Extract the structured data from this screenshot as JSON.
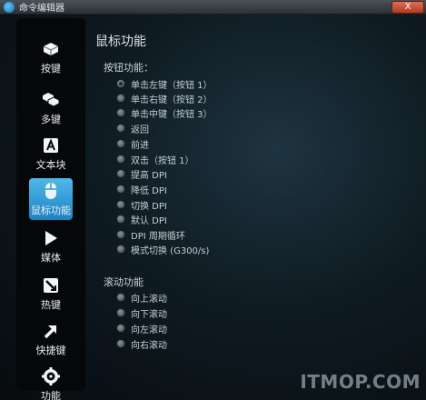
{
  "window": {
    "title": "命令编辑器",
    "close_label": "X"
  },
  "sidebar": {
    "items": [
      {
        "label": "按键",
        "icon": "key-icon",
        "active": false
      },
      {
        "label": "多键",
        "icon": "multi-key-icon",
        "active": false
      },
      {
        "label": "文本块",
        "icon": "text-block-icon",
        "active": false
      },
      {
        "label": "鼠标功能",
        "icon": "mouse-icon",
        "active": true
      },
      {
        "label": "媒体",
        "icon": "play-icon",
        "active": false
      },
      {
        "label": "热键",
        "icon": "hotkey-icon",
        "active": false
      },
      {
        "label": "快捷键",
        "icon": "shortcut-arrow-icon",
        "active": false
      },
      {
        "label": "功能",
        "icon": "function-gear-icon",
        "active": false
      }
    ]
  },
  "main": {
    "title": "鼠标功能",
    "button_section": {
      "label": "按钮功能：",
      "options": [
        {
          "label": "单击左键（按钮 1）",
          "checked": true
        },
        {
          "label": "单击右键（按钮 2）",
          "checked": false
        },
        {
          "label": "单击中键（按钮 3）",
          "checked": false
        },
        {
          "label": "返回",
          "checked": false
        },
        {
          "label": "前进",
          "checked": false
        },
        {
          "label": "双击（按钮 1）",
          "checked": false
        },
        {
          "label": "提高 DPI",
          "checked": false
        },
        {
          "label": "降低 DPI",
          "checked": false
        },
        {
          "label": "切换 DPI",
          "checked": false
        },
        {
          "label": "默认 DPI",
          "checked": false
        },
        {
          "label": "DPI 周期循环",
          "checked": false
        },
        {
          "label": "模式切换 (G300/s)",
          "checked": false
        }
      ]
    },
    "scroll_section": {
      "label": "滚动功能",
      "options": [
        {
          "label": "向上滚动",
          "checked": false
        },
        {
          "label": "向下滚动",
          "checked": false
        },
        {
          "label": "向左滚动",
          "checked": false
        },
        {
          "label": "向右滚动",
          "checked": false
        }
      ]
    }
  },
  "watermark": "ITMOP.COM",
  "colors": {
    "accent": "#2f9ed8",
    "background": "#0f1b22"
  }
}
